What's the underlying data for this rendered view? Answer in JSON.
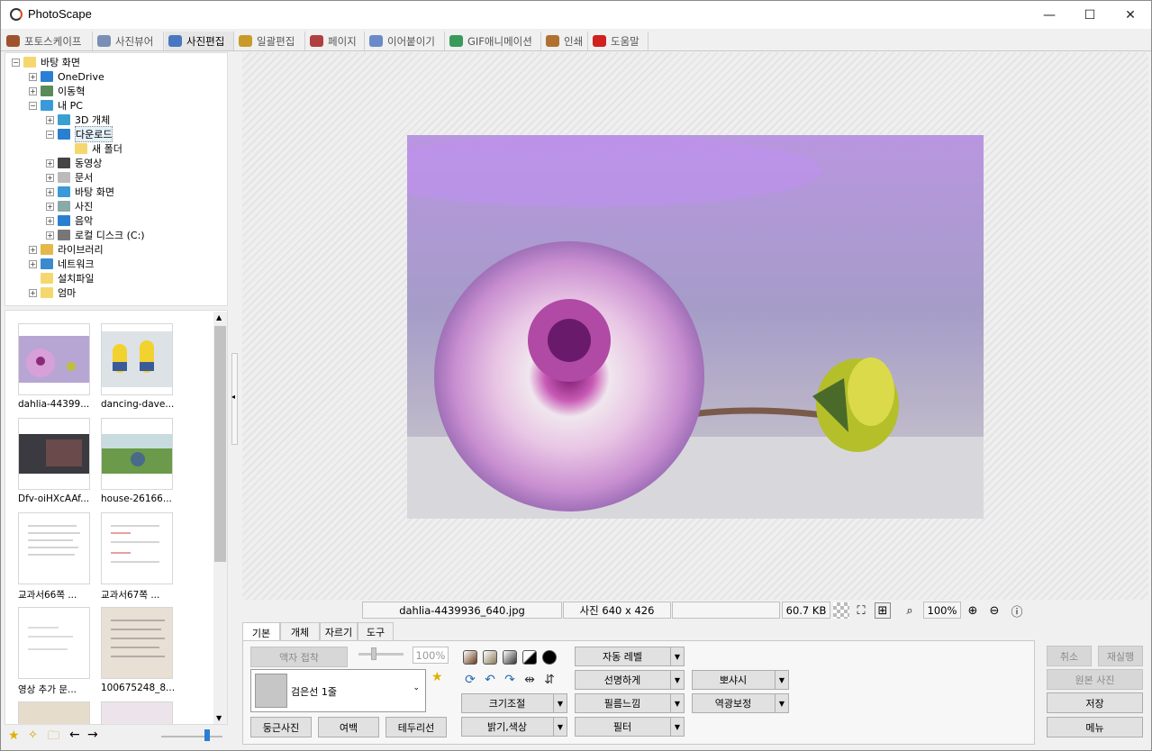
{
  "window": {
    "title": "PhotoScape",
    "minimize": "—",
    "maximize": "☐",
    "close": "✕"
  },
  "tabs": [
    {
      "label": "포토스케이프",
      "color": "#a0522d"
    },
    {
      "label": "사진뷰어",
      "color": "#7a8fb5"
    },
    {
      "label": "사진편집",
      "color": "#4a78c0"
    },
    {
      "label": "일괄편집",
      "color": "#c89a2a"
    },
    {
      "label": "페이지",
      "color": "#b04040"
    },
    {
      "label": "이어붙이기",
      "color": "#6a8ac8"
    },
    {
      "label": "GIF애니메이션",
      "color": "#3a9a5a"
    },
    {
      "label": "인쇄",
      "color": "#b07030"
    },
    {
      "label": "도움말",
      "color": "#d02020"
    }
  ],
  "tree": [
    {
      "label": "바탕 화면",
      "exp": "−",
      "color": "#f5d76e"
    },
    {
      "label": "OneDrive",
      "exp": "+",
      "color": "#2a7fd4"
    },
    {
      "label": "이동혁",
      "exp": "+",
      "color": "#5a8a5a"
    },
    {
      "label": "내 PC",
      "exp": "−",
      "color": "#3a9ad9"
    },
    {
      "label": "3D 개체",
      "exp": "+",
      "color": "#3aa0d0"
    },
    {
      "label": "다운로드",
      "exp": "−",
      "color": "#2a80d0"
    },
    {
      "label": "새 폴더",
      "exp": "",
      "color": "#f5d76e"
    },
    {
      "label": "동영상",
      "exp": "+",
      "color": "#444"
    },
    {
      "label": "문서",
      "exp": "+",
      "color": "#bbb"
    },
    {
      "label": "바탕 화면",
      "exp": "+",
      "color": "#3a9ad9"
    },
    {
      "label": "사진",
      "exp": "+",
      "color": "#8aa"
    },
    {
      "label": "음악",
      "exp": "+",
      "color": "#2a80d0"
    },
    {
      "label": "로컬 디스크 (C:)",
      "exp": "+",
      "color": "#777"
    },
    {
      "label": "라이브러리",
      "exp": "+",
      "color": "#e5b84a"
    },
    {
      "label": "네트워크",
      "exp": "+",
      "color": "#3a8ad0"
    },
    {
      "label": "설치파일",
      "exp": "",
      "color": "#f5d76e"
    },
    {
      "label": "엄마",
      "exp": "+",
      "color": "#f5d76e"
    }
  ],
  "thumbnails": [
    {
      "caption": "dahlia-44399...",
      "kind": "dahlia"
    },
    {
      "caption": "dancing-dave...",
      "kind": "minions"
    },
    {
      "caption": "Dfv-oiHXcAAf...",
      "kind": "dark"
    },
    {
      "caption": "house-26166...",
      "kind": "house"
    },
    {
      "caption": "교과서66쪽 ...",
      "kind": "doc"
    },
    {
      "caption": "교과서67쪽 ...",
      "kind": "doc2"
    },
    {
      "caption": "영상 추가 문...",
      "kind": "doc3"
    },
    {
      "caption": "100675248_8...",
      "kind": "notebook"
    },
    {
      "caption": "",
      "kind": "partial"
    },
    {
      "caption": "",
      "kind": "partial2"
    }
  ],
  "status": {
    "filename": "dahlia-4439936_640.jpg",
    "dimensions": "사진 640 x 426",
    "empty": "",
    "filesize": "60.7 KB",
    "zoom": "100%"
  },
  "edit_tabs": [
    "기본",
    "개체",
    "자르기",
    "도구"
  ],
  "panel": {
    "frame_button": "액자 접착",
    "slider_value": "100%",
    "frame_select": "검은선 1줄",
    "round_button": "둥근사진",
    "margin_button": "여백",
    "border_button": "테두리선",
    "resize": "크기조절",
    "brightness": "밝기,색상",
    "auto_level": "자동 레벨",
    "sharpen": "선명하게",
    "film": "필름느낌",
    "filter": "필터",
    "bloom": "뽀샤시",
    "backlight": "역광보정"
  },
  "right": {
    "undo": "취소",
    "redo": "재실행",
    "original": "원본 사진",
    "save": "저장",
    "menu": "메뉴"
  }
}
